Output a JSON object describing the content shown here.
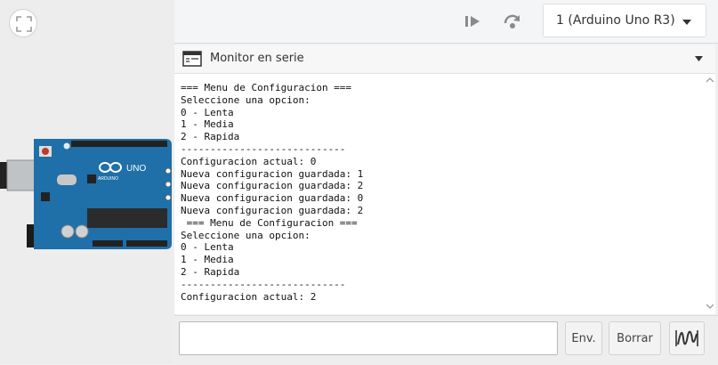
{
  "toolbar": {
    "start_icon": "step-forward-icon",
    "step_icon": "step-over-icon",
    "device_select": "1 (Arduino Uno R3)"
  },
  "board": {
    "brand": "ARDUINO",
    "model": "UNO"
  },
  "serial": {
    "title": "Monitor en serie",
    "lines": [
      "=== Menu de Configuracion ===",
      "Seleccione una opcion:",
      "0 - Lenta",
      "1 - Media",
      "2 - Rapida",
      "----------------------------",
      "Configuracion actual: 0",
      "Nueva configuracion guardada: 1",
      "Nueva configuracion guardada: 2",
      "Nueva configuracion guardada: 0",
      "Nueva configuracion guardada: 2",
      " === Menu de Configuracion ===",
      "Seleccione una opcion:",
      "0 - Lenta",
      "1 - Media",
      "2 - Rapida",
      "----------------------------",
      "Configuracion actual: 2"
    ]
  },
  "input": {
    "value": "",
    "send_label": "Env.",
    "clear_label": "Borrar",
    "plot_icon": "waveform-icon"
  },
  "colors": {
    "board_blue": "#1f6fa8",
    "toolbar_bg": "#f4f5f6"
  }
}
